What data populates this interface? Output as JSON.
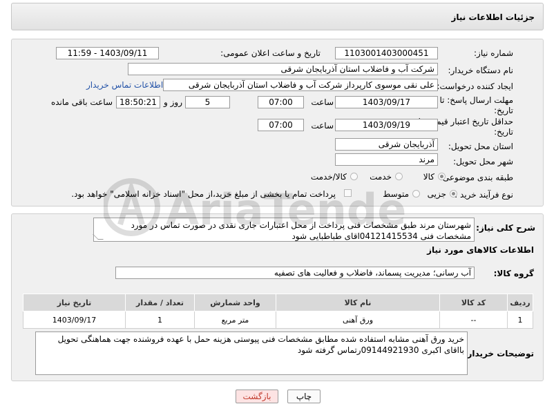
{
  "page_title": "جزئیات اطلاعات نیاز",
  "need_number": {
    "label": "شماره نیاز:",
    "value": "1103001403000451"
  },
  "announce_datetime": {
    "label": "تاریخ و ساعت اعلان عمومی:",
    "value": "1403/09/11 - 11:59"
  },
  "buyer_org": {
    "label": "نام دستگاه خریدار:",
    "value": "شرکت آب و فاضلاب استان آذربایجان شرقی"
  },
  "requester": {
    "label": "ایجاد کننده درخواست:",
    "value": "علی نقی موسوی کارپرداز شرکت آب و فاضلاب استان آذربایجان شرقی",
    "contact_link": "اطلاعات تماس خریدار"
  },
  "deadline": {
    "label_line1": "مهلت ارسال پاسخ: تا",
    "label_line2": "تاریخ:",
    "date": "1403/09/17",
    "time_label": "ساعت",
    "time": "07:00",
    "days": "5",
    "days_label": "روز و",
    "remaining": "18:50:21",
    "remaining_label": "ساعت باقی مانده"
  },
  "validity": {
    "label_line1": "حداقل تاریخ اعتبار قیمت: تا",
    "label_line2": "تاریخ:",
    "date": "1403/09/19",
    "time_label": "ساعت",
    "time": "07:00"
  },
  "province": {
    "label": "استان محل تحویل:",
    "value": "آذربایجان شرقی"
  },
  "city": {
    "label": "شهر محل تحویل:",
    "value": "مرند"
  },
  "category": {
    "label": "طبقه بندی موضوعی:",
    "options": [
      "کالا",
      "خدمت",
      "کالا/خدمت"
    ],
    "selected": "کالا"
  },
  "purchase_type": {
    "label": "نوع فرآیند خرید :",
    "options": [
      "جزیی",
      "متوسط"
    ],
    "selected": "جزیی",
    "note": "پرداخت تمام یا بخشی از مبلغ خرید،از محل \"اسناد خزانه اسلامی\" خواهد بود."
  },
  "description": {
    "label": "شرح کلی نیاز:",
    "text": "شهرستان مرند طبق مشخصات فنی پرداخت از محل اعتبارات جاری  نقدی در صورت تماس در مورد مشخصات فنی 04121415534اقای  طباطبایی  شود"
  },
  "goods_section_title": "اطلاعات کالاهای مورد نیاز",
  "goods_group": {
    "label": "گروه کالا:",
    "value": "آب رسانی؛ مدیریت پسماند، فاضلاب و فعالیت های تصفیه"
  },
  "table": {
    "headers": [
      "ردیف",
      "کد کالا",
      "نام کالا",
      "واحد شمارش",
      "تعداد / مقدار",
      "تاریخ نیاز"
    ],
    "rows": [
      [
        "1",
        "--",
        "ورق آهنی",
        "متر مربع",
        "1",
        "1403/09/17"
      ]
    ]
  },
  "buyer_notes": {
    "label": "توضیحات خریدار:",
    "text": "خرید ورق آهنی  مشابه استفاده شده مطابق مشخصات فنی پیوستی  هزینه حمل با عهده فروشنده جهت هماهنگی تحویل بااقای اکبری 09144921930رتماس گرفته شود"
  },
  "buttons": {
    "print": "چاپ",
    "back": "بازگشت"
  },
  "watermark_text": "AriaTender.neT",
  "colors": {
    "link": "#2453a8",
    "back_button_bg": "#fde3e3",
    "back_button_text": "#c0392b"
  }
}
